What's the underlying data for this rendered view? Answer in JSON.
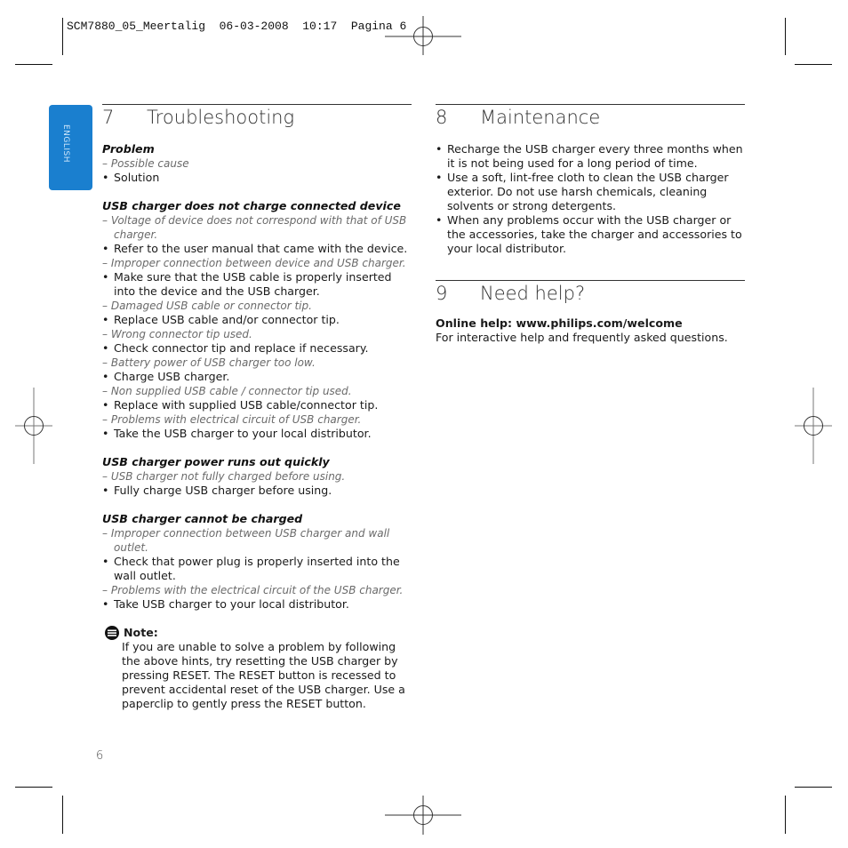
{
  "slug": "SCM7880_05_Meertalig  06-03-2008  10:17  Pagina 6",
  "language_tab": "ENGLISH",
  "page_number": "6",
  "troubleshooting": {
    "number": "7",
    "title": "Troubleshooting",
    "legend": {
      "problem": "Problem",
      "cause": "Possible cause",
      "solution": "Solution"
    },
    "groups": [
      {
        "problem": "USB charger does not charge connected device",
        "items": [
          {
            "cause": "Voltage of device does not correspond with that of USB charger.",
            "solution": "Refer to the user manual that came with the device."
          },
          {
            "cause": "Improper connection between device and USB charger.",
            "solution": "Make sure that the USB cable is properly inserted into the device and the USB charger."
          },
          {
            "cause": "Damaged USB cable or connector tip.",
            "solution": "Replace USB cable and/or connector tip."
          },
          {
            "cause": "Wrong connector tip used.",
            "solution": "Check connector tip and replace if necessary."
          },
          {
            "cause": "Battery power of USB charger too low.",
            "solution": "Charge USB charger."
          },
          {
            "cause": "Non supplied USB cable / connector tip used.",
            "solution": "Replace with supplied USB cable/connector tip."
          },
          {
            "cause": "Problems with electrical circuit of USB charger.",
            "solution": "Take the USB charger to your local distributor."
          }
        ]
      },
      {
        "problem": "USB charger power runs out quickly",
        "items": [
          {
            "cause": "USB charger not fully charged before using.",
            "solution": "Fully charge USB charger before using."
          }
        ]
      },
      {
        "problem": "USB charger cannot be charged",
        "items": [
          {
            "cause": "Improper connection between USB charger and wall outlet.",
            "solution": "Check that power plug is properly inserted into the wall outlet."
          },
          {
            "cause": "Problems with the electrical circuit of the USB charger.",
            "solution": "Take USB charger to your local distributor."
          }
        ]
      }
    ],
    "note": {
      "label": "Note:",
      "text": "If you are unable to solve a problem by following the above hints, try resetting the USB charger by pressing RESET. The RESET button is recessed to prevent accidental reset of the USB charger. Use a paperclip to gently press the RESET button."
    }
  },
  "maintenance": {
    "number": "8",
    "title": "Maintenance",
    "items": [
      "Recharge the USB charger every three months when it is not being used for a long period of time.",
      "Use a soft, lint-free cloth to clean the USB charger exterior. Do not use harsh chemicals, cleaning solvents or strong detergents.",
      "When any problems occur with the USB charger or the accessories, take the charger and accessories to your local distributor."
    ]
  },
  "help": {
    "number": "9",
    "title": "Need help?",
    "online_label": "Online help: www.philips.com/welcome",
    "online_text": "For interactive help and frequently asked questions."
  },
  "colors": {
    "language_tab": "#1a7fcf"
  }
}
